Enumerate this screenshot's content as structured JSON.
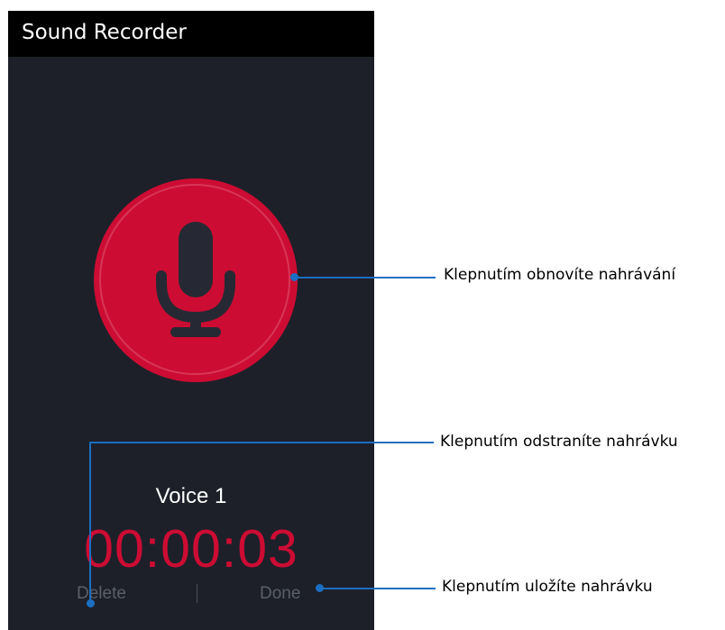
{
  "app": {
    "title": "Sound Recorder"
  },
  "recorder": {
    "record_icon": "microphone-icon",
    "recording_name": "Voice 1",
    "elapsed_time": "00:00:03"
  },
  "actions": {
    "delete_label": "Delete",
    "done_label": "Done"
  },
  "callouts": {
    "resume": "Klepnutím obnovíte nahrávání",
    "delete": "Klepnutím odstraníte nahrávku",
    "save": "Klepnutím uložíte nahrávku"
  },
  "colors": {
    "screen_background": "#1d2029",
    "title_bar": "#000000",
    "record_button": "#cd0c33",
    "timer_text": "#cd0c33",
    "callout_line": "#1b6fc2"
  }
}
